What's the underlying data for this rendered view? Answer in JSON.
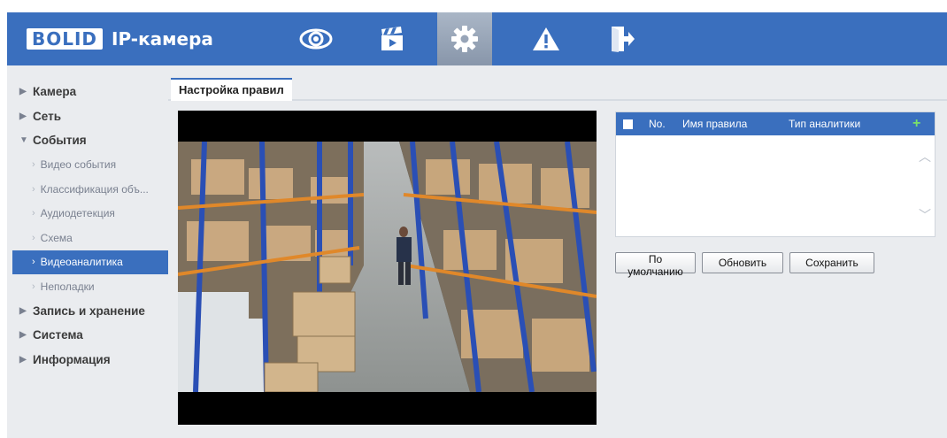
{
  "header": {
    "logo_brand": "BOLID",
    "logo_text": "IP-камера",
    "nav": [
      {
        "icon": "eye-icon"
      },
      {
        "icon": "clapperboard-icon"
      },
      {
        "icon": "gear-icon",
        "active": true
      },
      {
        "icon": "warning-icon"
      },
      {
        "icon": "logout-icon"
      }
    ],
    "accent_color": "#3a6fbe"
  },
  "sidebar": {
    "items": [
      {
        "label": "Камера",
        "expanded": false
      },
      {
        "label": "Сеть",
        "expanded": false
      },
      {
        "label": "События",
        "expanded": true,
        "children": [
          "Видео события",
          "Классификация объ...",
          "Аудиодетекция",
          "Схема",
          "Видеоаналитика",
          "Неполадки"
        ],
        "active_child": "Видеоаналитика"
      },
      {
        "label": "Запись и хранение",
        "expanded": false
      },
      {
        "label": "Система",
        "expanded": false
      },
      {
        "label": "Информация",
        "expanded": false
      }
    ]
  },
  "tab": {
    "label": "Настройка правил"
  },
  "rules_table": {
    "columns": {
      "no": "No.",
      "name": "Имя правила",
      "type": "Тип аналитики",
      "add": "+"
    },
    "rows": []
  },
  "buttons": {
    "default": "По умолчанию",
    "refresh": "Обновить",
    "save": "Сохранить"
  }
}
